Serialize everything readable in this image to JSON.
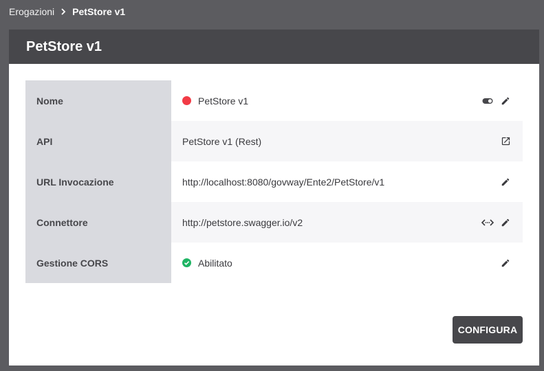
{
  "breadcrumb": {
    "parent": "Erogazioni",
    "current": "PetStore v1"
  },
  "panel": {
    "title": "PetStore v1"
  },
  "rows": [
    {
      "label": "Nome",
      "value": "PetStore v1"
    },
    {
      "label": "API",
      "value": "PetStore v1 (Rest)"
    },
    {
      "label": "URL Invocazione",
      "value": "http://localhost:8080/govway/Ente2/PetStore/v1"
    },
    {
      "label": "Connettore",
      "value": "http://petstore.swagger.io/v2"
    },
    {
      "label": "Gestione CORS",
      "value": "Abilitato"
    }
  ],
  "actions": {
    "configure_label": "CONFIGURA"
  },
  "colors": {
    "status_disabled": "#f23b46",
    "status_enabled": "#1fb464",
    "header_bg": "#47474b",
    "label_bg": "#d9dadf"
  }
}
